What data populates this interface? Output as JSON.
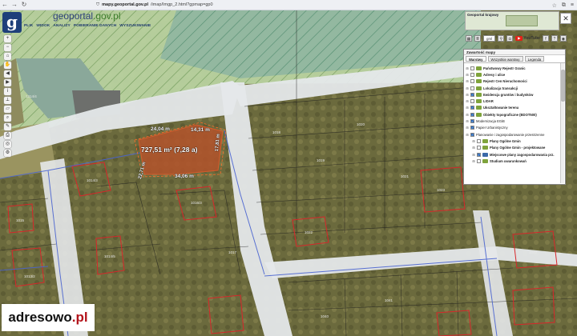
{
  "browser": {
    "url_host": "mapy.geoportal.gov.pl",
    "url_path": "/imap/Imgp_2.html?gpmap=gp0"
  },
  "app": {
    "logo_letter": "g",
    "brand_left": "geoportal",
    "brand_right": ".gov.pl",
    "menu": [
      "PLIK",
      "WIDOK",
      "ANALIZY",
      "POBIERANIE DANYCH",
      "WYSZUKIWANIE"
    ]
  },
  "minimap": {
    "title": "Geoportal krajowy"
  },
  "top_tools": {
    "select_label": "gml",
    "youtube_label": "YouTube"
  },
  "layers_panel": {
    "title": "Zawartość mapy",
    "tabs": [
      "Warstwy",
      "Wszystkie warstwy",
      "Legenda"
    ],
    "rows": [
      {
        "label": "Państwowy Rejestr Granic",
        "checked": false,
        "bold": true,
        "folder": "green",
        "indent": 0
      },
      {
        "label": "Adresy i ulice",
        "checked": false,
        "bold": true,
        "folder": "green",
        "indent": 0
      },
      {
        "label": "Rejestr Cen Nieruchomości",
        "checked": false,
        "bold": true,
        "folder": "green",
        "indent": 0
      },
      {
        "label": "Lokalizacja transakcji",
        "checked": false,
        "bold": true,
        "folder": "green",
        "indent": 0
      },
      {
        "label": "Ewidencja gruntów i budynków",
        "checked": true,
        "bold": true,
        "folder": "green",
        "indent": 0
      },
      {
        "label": "LIDAR",
        "checked": false,
        "bold": true,
        "folder": "green",
        "indent": 0
      },
      {
        "label": "Ukształtowanie terenu",
        "checked": true,
        "bold": true,
        "folder": "green",
        "indent": 0
      },
      {
        "label": "Obiekty topograficzne (BDOT500)",
        "checked": true,
        "bold": true,
        "folder": "green",
        "indent": 0
      },
      {
        "label": "Modernizacja EGiB",
        "checked": true,
        "bold": false,
        "folder": "",
        "indent": 0
      },
      {
        "label": "Papier Urbanistyczny",
        "checked": true,
        "bold": false,
        "folder": "",
        "indent": 0
      },
      {
        "label": "Planowanie i zagospodarowanie przestrzenne",
        "checked": true,
        "bold": false,
        "folder": "",
        "indent": 0
      },
      {
        "label": "Plany Ogólne Gmin",
        "checked": false,
        "bold": true,
        "folder": "green",
        "indent": 1
      },
      {
        "label": "Plany Ogólne Gmin - projektowane",
        "checked": false,
        "bold": true,
        "folder": "green",
        "indent": 1
      },
      {
        "label": "Miejscowe plany zagospodarowania prz.",
        "checked": true,
        "bold": true,
        "folder": "blue",
        "indent": 1
      },
      {
        "label": "Studium uwarunkowań",
        "checked": false,
        "bold": true,
        "folder": "green",
        "indent": 1
      }
    ]
  },
  "parcel": {
    "area": "727,51 m² (7,28 a)",
    "dim_top": "24,04 m",
    "dim_top_right": "14,31 m",
    "dim_right": "17,81 m",
    "dim_left": "22,71 m",
    "dim_bottom": "34,06 m"
  },
  "plot_numbers": [
    "1014/4",
    "1014/3",
    "1015",
    "1014/5",
    "1013/2",
    "1016/3",
    "1017",
    "1018",
    "1019",
    "1020",
    "1021",
    "1022",
    "1023",
    "1040",
    "1041",
    "1042"
  ],
  "watermark": {
    "main": "adresowo",
    "suffix": ".pl"
  }
}
